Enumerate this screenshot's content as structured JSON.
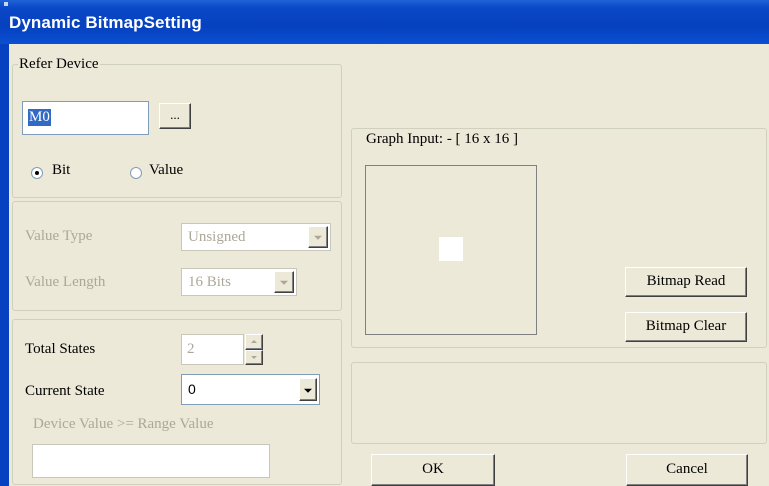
{
  "window": {
    "title": "Dynamic BitmapSetting"
  },
  "refer_device": {
    "legend": "Refer Device",
    "device_value": "M0",
    "browse_label": "...",
    "bit_label": "Bit",
    "value_label": "Value",
    "selected": "Bit"
  },
  "value_group": {
    "value_type_label": "Value Type",
    "value_type": "Unsigned",
    "value_length_label": "Value Length",
    "value_length": "16 Bits"
  },
  "states": {
    "total_states_label": "Total States",
    "total_states": "2",
    "current_state_label": "Current State",
    "current_state": "0",
    "range_caption": "Device Value >= Range Value",
    "range_value": ""
  },
  "graph": {
    "label": "Graph Input: - [ 16 x 16 ]",
    "read_button": "Bitmap Read",
    "clear_button": "Bitmap Clear"
  },
  "footer": {
    "ok_label": "OK",
    "cancel_label": "Cancel"
  },
  "colors": {
    "title_bar": "#0a48c7",
    "dialog_bg": "#ece9d8",
    "disabled_text": "#aca899",
    "selection": "#316ac5"
  }
}
